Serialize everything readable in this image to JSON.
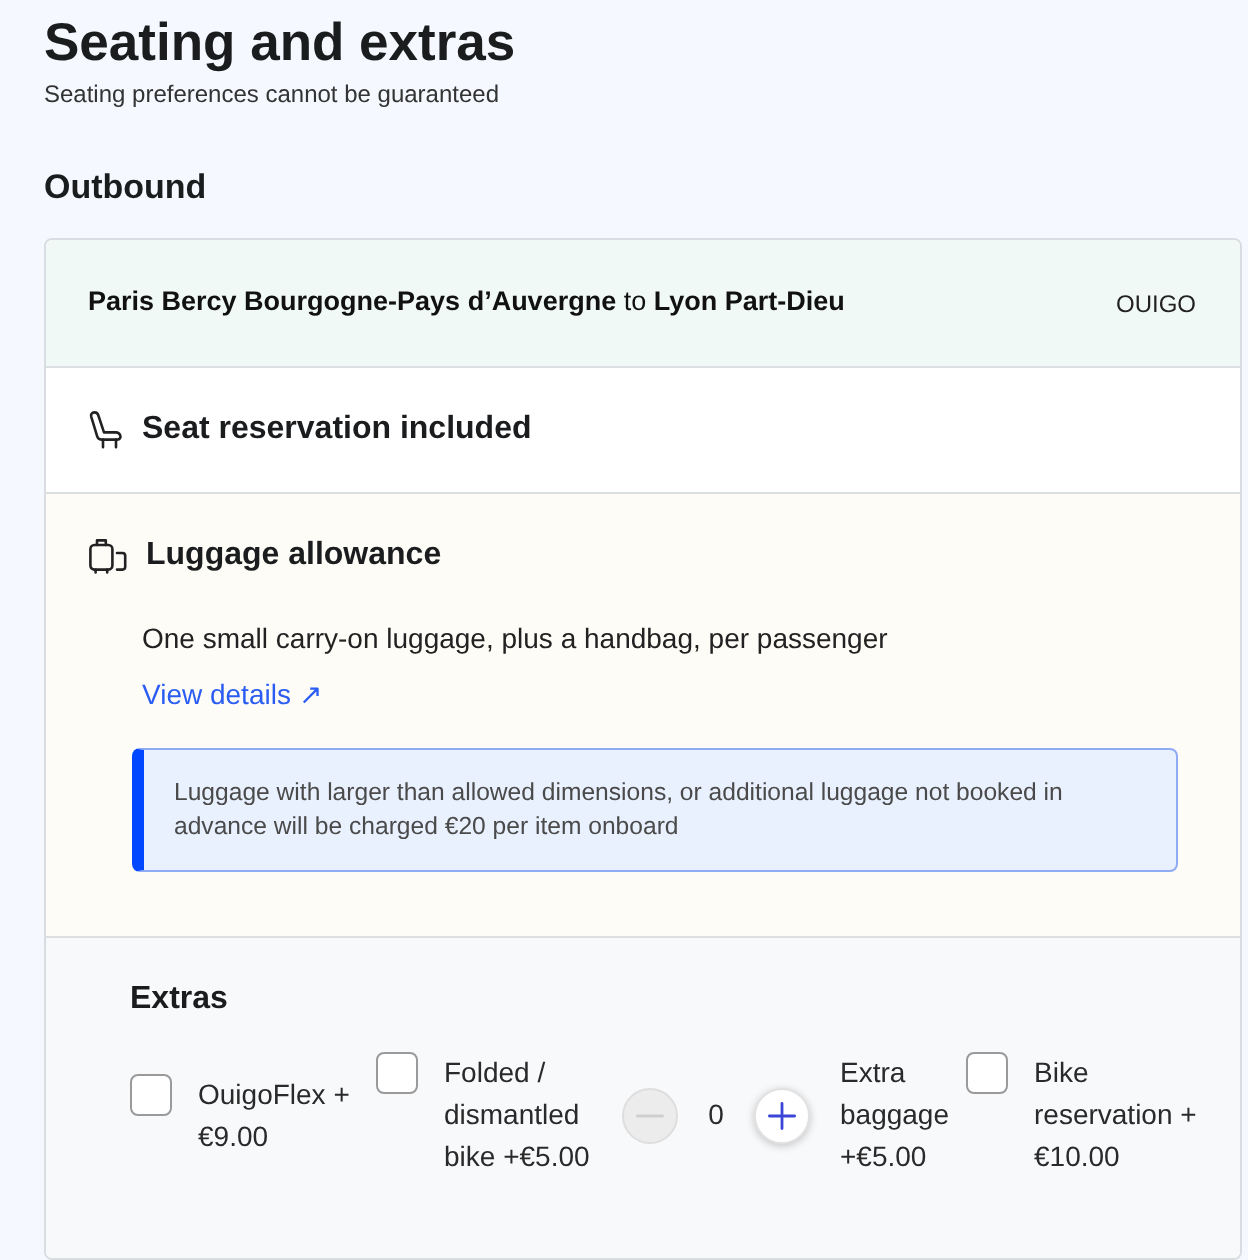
{
  "page": {
    "title": "Seating and extras",
    "subtitle": "Seating preferences cannot be guaranteed"
  },
  "outbound": {
    "heading": "Outbound",
    "route": "**Paris Bercy Bourgogne-Pays d’Auvergne** to **Lyon Part-Dieu**",
    "operator": "OUIGO",
    "seat": {
      "title": "Seat reservation included"
    },
    "luggage": {
      "title": "Luggage allowance",
      "description": "One small carry-on luggage, plus a handbag, per passenger",
      "link": "View details ↗",
      "notice": "Luggage with larger than allowed dimensions, or additional luggage not booked in advance will be charged €20 per item onboard"
    },
    "extras": {
      "title": "Extras",
      "items": [
        {
          "kind": "checkbox",
          "label": "OuigoFlex + €9.00",
          "checked": false
        },
        {
          "kind": "checkbox",
          "label": "Folded / dismantled bike +€5.00",
          "checked": false
        },
        {
          "kind": "counter",
          "count": "0",
          "label": "Extra baggage +€5.00",
          "decrease_disabled": true,
          "increase_disabled": false
        },
        {
          "kind": "checkbox",
          "label": "Bike reservation + €10.00",
          "checked": false
        }
      ]
    }
  }
}
